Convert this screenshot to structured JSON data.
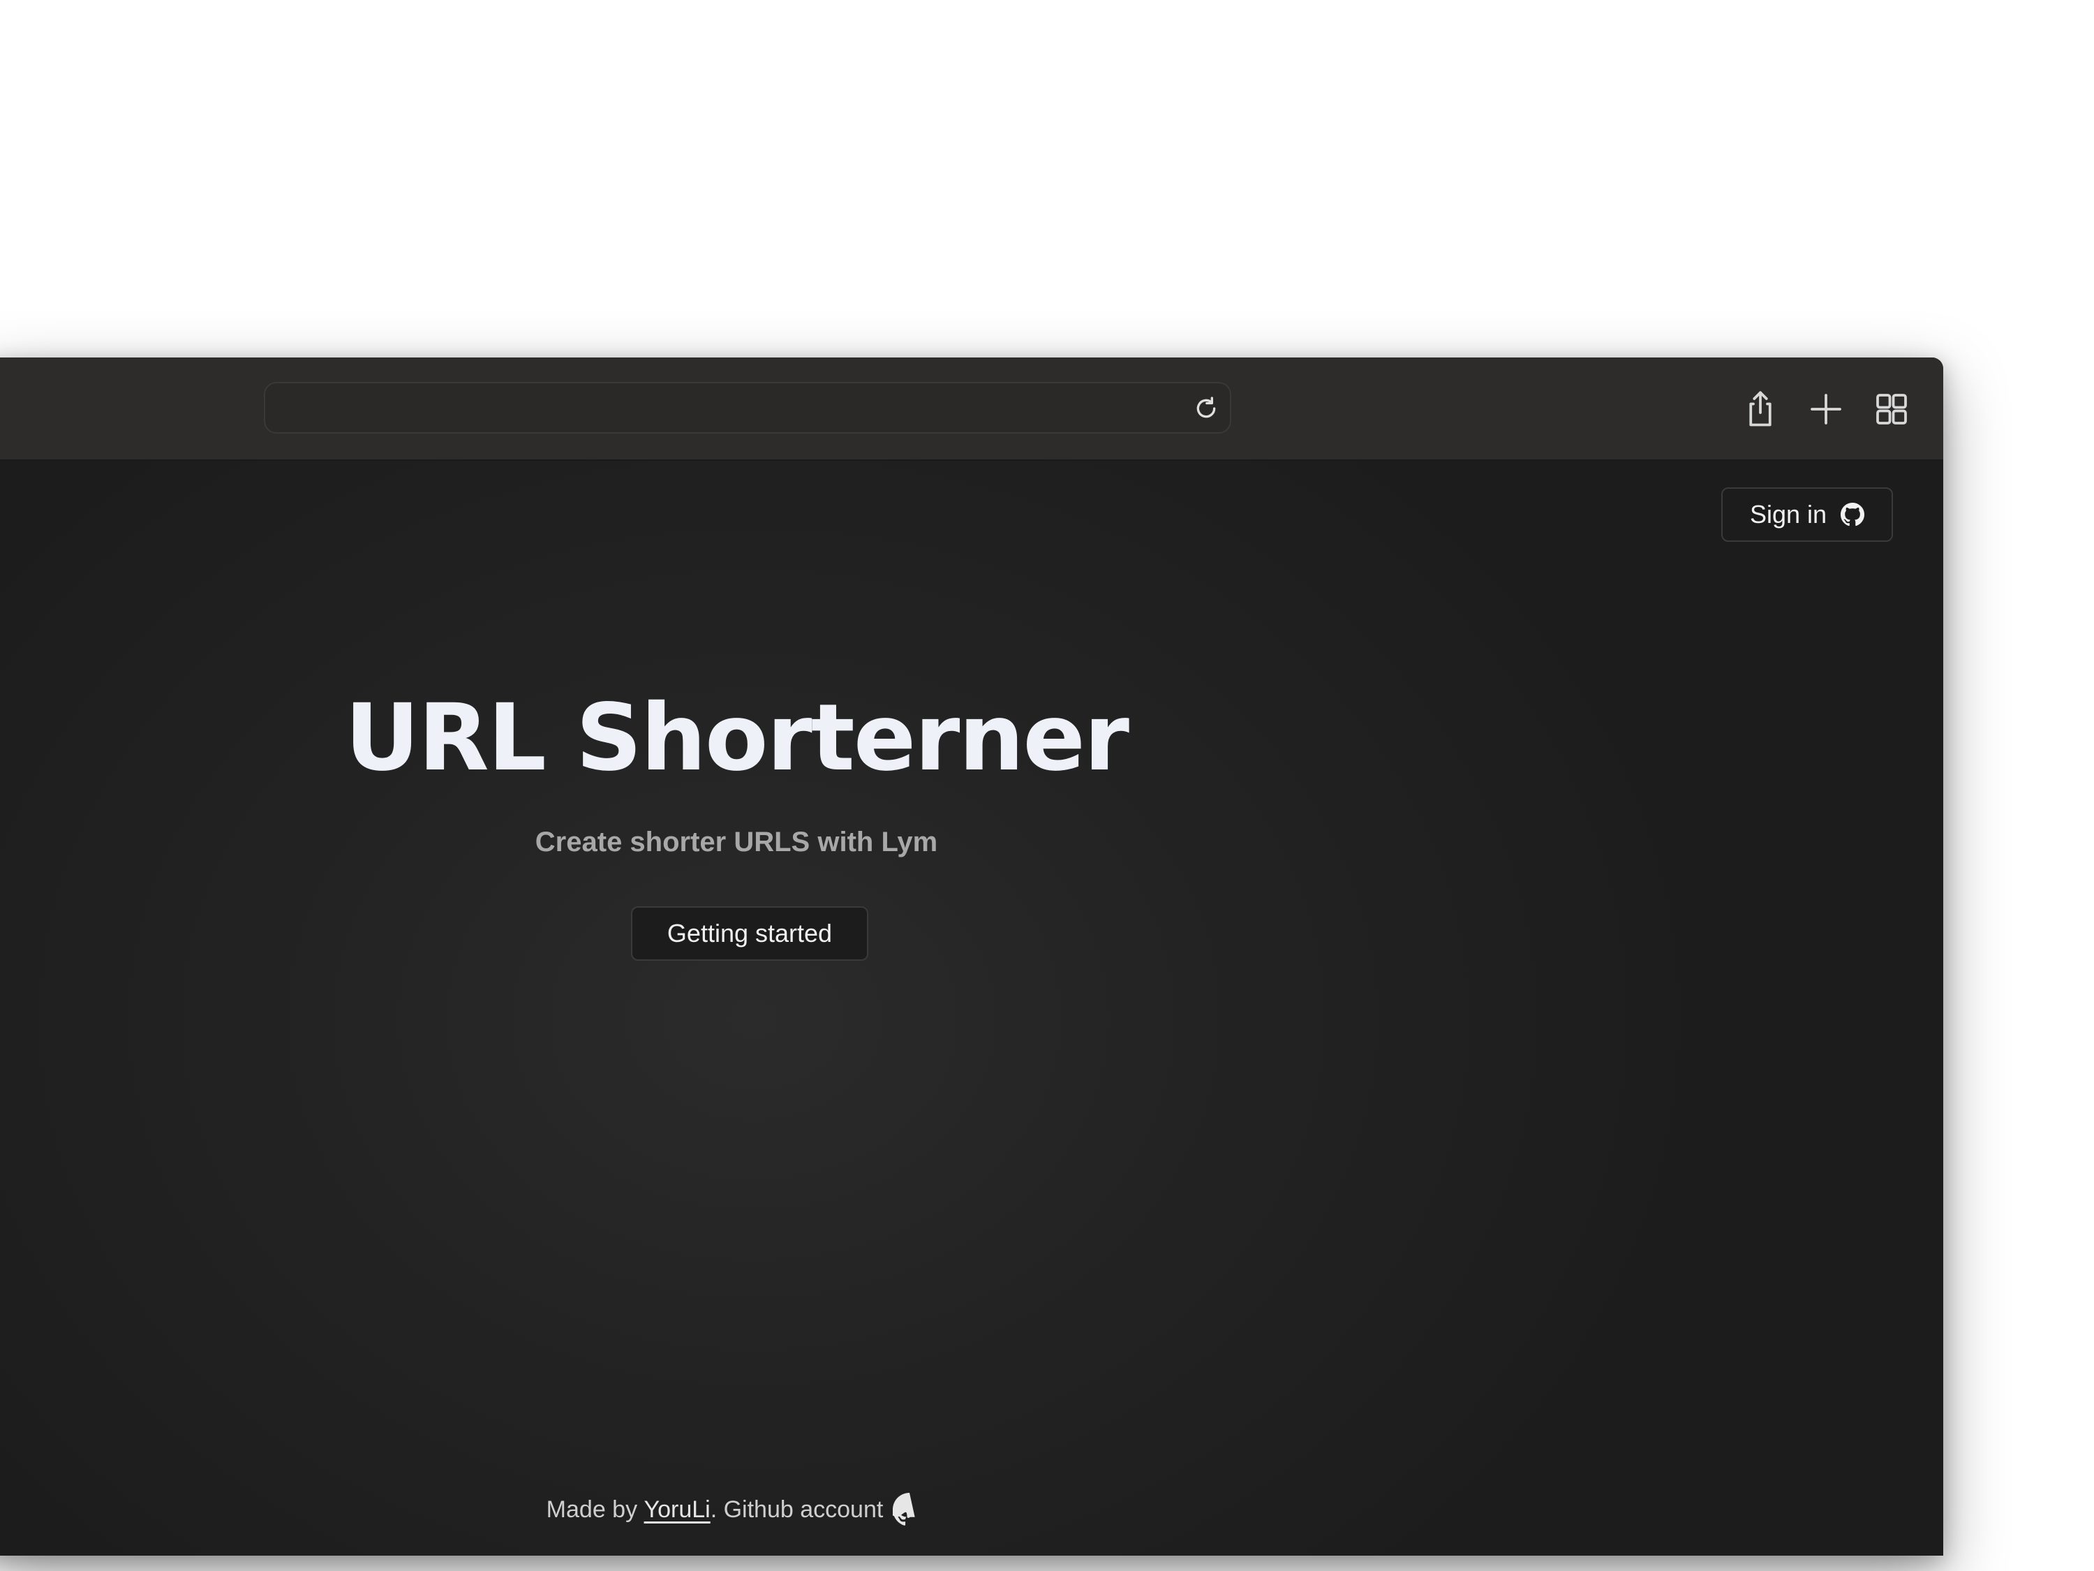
{
  "browser": {
    "address_value": "",
    "icons": {
      "reload": "reload-icon",
      "share": "share-icon",
      "new_tab": "plus-icon",
      "tab_overview": "grid-icon"
    }
  },
  "header": {
    "signin_label": "Sign in",
    "signin_icon": "github-icon"
  },
  "hero": {
    "title": "URL Shorterner",
    "subtitle": "Create shorter URLS with Lym",
    "cta_label": "Getting started"
  },
  "footer": {
    "prefix": "Made by ",
    "author": "YoruLi",
    "suffix": ". Github account",
    "icon": "github-icon"
  },
  "colors": {
    "page_background": "#1f1f1f",
    "toolbar_background": "#2d2c2b",
    "title_text": "#eef2f8",
    "subtitle_text": "#a8a8a8",
    "button_border": "#3a3a3a"
  }
}
